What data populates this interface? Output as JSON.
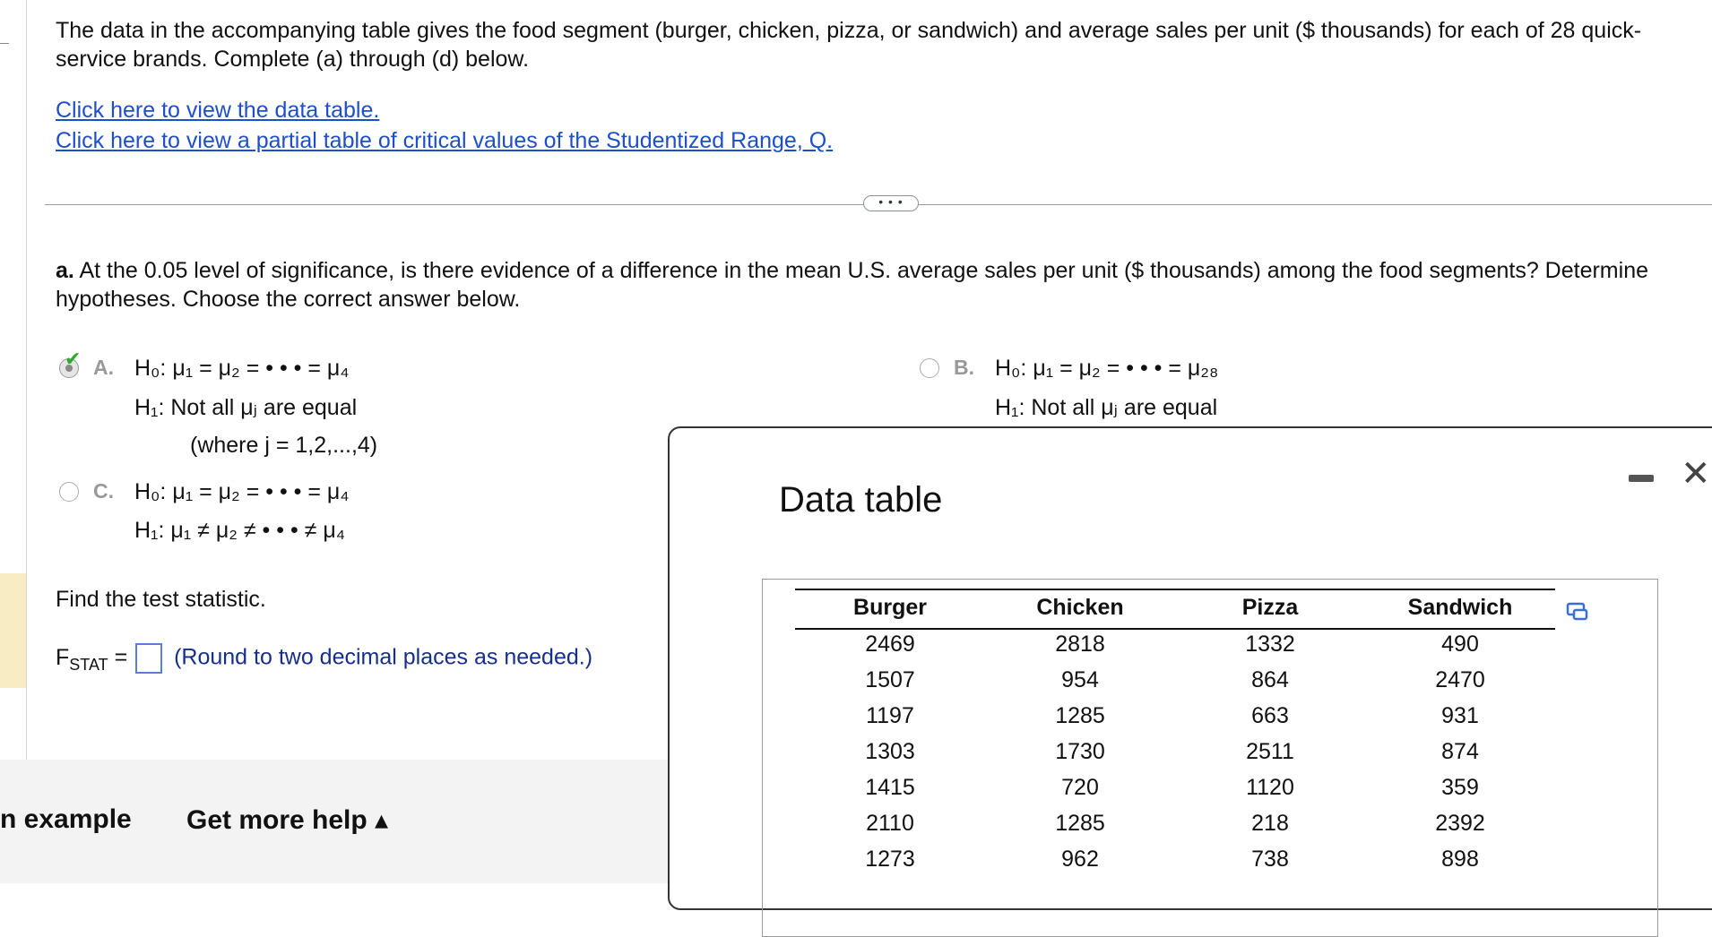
{
  "intro": "The data in the accompanying table gives the food segment (burger, chicken, pizza, or sandwich) and average sales per unit ($ thousands) for each of 28 quick-service brands. Complete (a) through (d) below.",
  "links": {
    "data_table": "Click here to view the data table.",
    "critical_values": "Click here to view a partial table of critical values of the Studentized Range, Q."
  },
  "separator_label": "• • •",
  "question": {
    "label": "a.",
    "text": "At the 0.05 level of significance, is there evidence of a difference in the mean U.S. average sales per unit ($ thousands) among the food segments? Determine hypotheses. Choose the correct answer below."
  },
  "options": {
    "a": {
      "letter": "A.",
      "h0": "H₀: μ₁ = μ₂ = • • • = μ₄",
      "h1": "H₁: Not all μⱼ are equal",
      "where": "(where j = 1,2,...,4)",
      "selected": true
    },
    "b": {
      "letter": "B.",
      "h0": "H₀: μ₁ = μ₂ = • • • = μ₂₈",
      "h1": "H₁: Not all μⱼ are equal",
      "selected": false
    },
    "c": {
      "letter": "C.",
      "h0": "H₀: μ₁ = μ₂ = • • • = μ₄",
      "h1": "H₁: μ₁ ≠ μ₂ ≠ • • • ≠ μ₄",
      "selected": false
    }
  },
  "test_stat": {
    "prompt": "Find the test statistic.",
    "label_main": "F",
    "label_sub": "STAT",
    "equals": "=",
    "note": "(Round to two decimal places as needed.)"
  },
  "bottom": {
    "example": "n example",
    "help": "Get more help ▴"
  },
  "dialog": {
    "title": "Data table",
    "minimize": "–",
    "close": "✕",
    "headers": [
      "Burger",
      "Chicken",
      "Pizza",
      "Sandwich"
    ],
    "rows": [
      [
        "2469",
        "2818",
        "1332",
        "490"
      ],
      [
        "1507",
        "954",
        "864",
        "2470"
      ],
      [
        "1197",
        "1285",
        "663",
        "931"
      ],
      [
        "1303",
        "1730",
        "2511",
        "874"
      ],
      [
        "1415",
        "720",
        "1120",
        "359"
      ],
      [
        "2110",
        "1285",
        "218",
        "2392"
      ],
      [
        "1273",
        "962",
        "738",
        "898"
      ]
    ]
  },
  "colors": {
    "link": "#1c4fc9",
    "check": "#2eaa2e",
    "note": "#162f8a"
  }
}
